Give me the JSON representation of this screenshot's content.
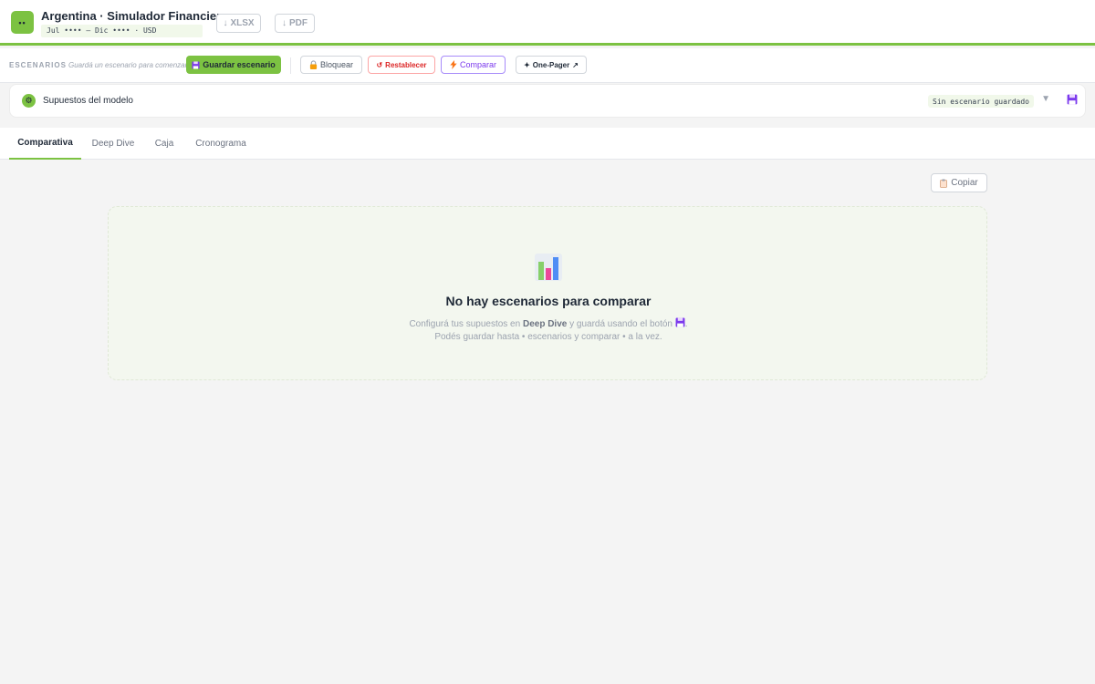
{
  "header": {
    "logo_glyph": "••",
    "title": "Argentina · Simulador Financiero",
    "period": "Jul •••• — Dic •••• · USD",
    "export_xlsx": "XLSX",
    "export_pdf": "PDF",
    "download_glyph": "↓"
  },
  "scenario_bar": {
    "label": "ESCENARIOS",
    "hint": "Guardá un escenario para comenzar",
    "save_label": "Guardar escenario",
    "lock_label": "Bloquear",
    "reset_label": "Restablecer",
    "compare_label": "Comparar",
    "onepager_label": "One-Pager",
    "onepager_prefix": "✦",
    "onepager_suffix": "↗"
  },
  "assumptions": {
    "title": "Supuestos del modelo",
    "status": "Sin escenario guardado",
    "caret": "▼"
  },
  "tabs": [
    {
      "label": "Comparativa",
      "active": true
    },
    {
      "label": "Deep Dive",
      "active": false
    },
    {
      "label": "Caja",
      "active": false
    },
    {
      "label": "Cronograma",
      "active": false
    }
  ],
  "copy_label": "Copiar",
  "empty_state": {
    "title": "No hay escenarios para comparar",
    "line1_before": "Configurá tus supuestos en",
    "line1_bold": "Deep Dive",
    "line1_after": "y guardá usando el botón",
    "line1_end": ".",
    "line2": "Podés guardar hasta • escenarios y comparar • a la vez."
  },
  "icons": {
    "logo": "logo-icon",
    "download": "download-icon",
    "save": "floppy-disk-icon",
    "lock": "lock-icon",
    "reset": "reset-icon",
    "compare": "lightning-icon",
    "gear": "gear-icon",
    "clipboard": "clipboard-icon",
    "chart": "bar-chart-icon"
  },
  "colors": {
    "accent_green": "#7cc242",
    "reset_red": "#dc2626",
    "compare_purple": "#7c3aed"
  }
}
